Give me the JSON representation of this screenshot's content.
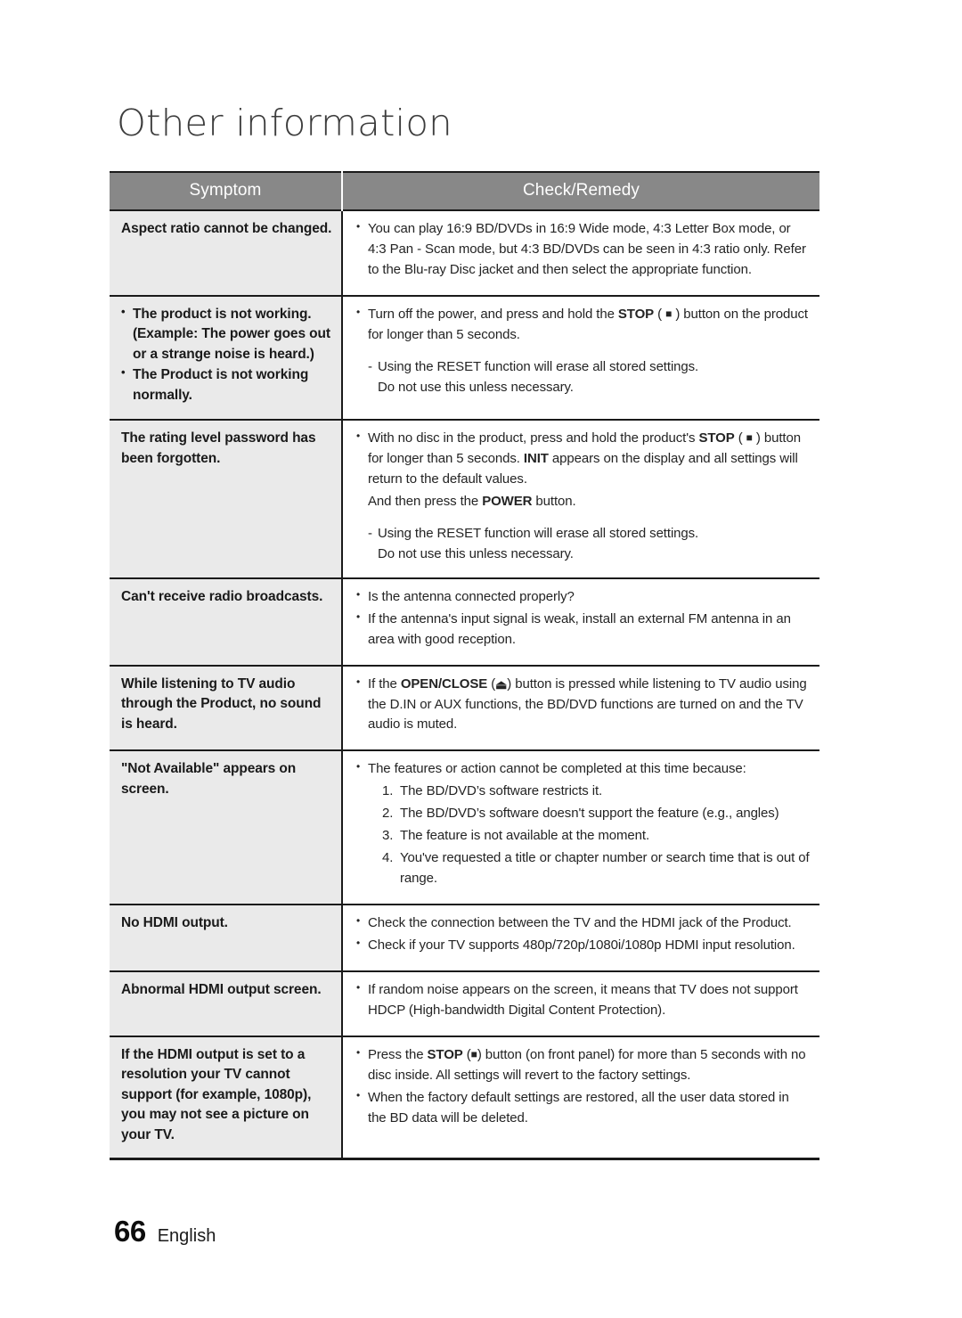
{
  "page": {
    "chapter_title": "Other information",
    "footer": {
      "page_number": "66",
      "language": "English"
    }
  },
  "table": {
    "headers": {
      "symptom": "Symptom",
      "remedy": "Check/Remedy"
    },
    "header_bg": "#888888",
    "symptom_cell_bg": "#eaeaea",
    "rows": [
      {
        "symptom_lines": [
          "Aspect ratio cannot be changed."
        ],
        "symptom_bulleted": false,
        "remedy_bullets": [
          "You can play 16:9 BD/DVDs in 16:9 Wide mode, 4:3 Letter Box mode, or 4:3 Pan - Scan mode, but 4:3 BD/DVDs can be seen in 4:3 ratio only. Refer to the Blu-ray Disc jacket and then select the appropriate function."
        ]
      },
      {
        "symptom_lines": [
          "The product is not working. (Example: The power goes out or a strange noise is heard.)",
          "The Product is not working normally."
        ],
        "symptom_bulleted": true,
        "remedy_bullets": [
          "Turn off the power, and press and hold the STOP ( ■ ) button on the product for longer than 5 seconds."
        ],
        "remedy_note_dash": "Using the RESET function will erase all stored settings.",
        "remedy_note_cont": "Do not use this unless necessary."
      },
      {
        "symptom_lines": [
          "The rating level password has been forgotten."
        ],
        "symptom_bulleted": false,
        "remedy_bullets": [
          "With no disc in the product, press and hold the product's STOP ( ■ ) button for longer than 5 seconds. INIT appears on the display and all settings will return to the default values."
        ],
        "remedy_plain": "And then press the POWER button.",
        "remedy_note_dash": "Using the RESET function will erase all stored settings.",
        "remedy_note_cont": "Do not use this unless necessary."
      },
      {
        "symptom_lines": [
          "Can't receive radio broadcasts."
        ],
        "symptom_bulleted": false,
        "remedy_bullets": [
          "Is the antenna connected properly?",
          "If the antenna's input signal is weak, install an external FM antenna in an area with good reception."
        ]
      },
      {
        "symptom_lines": [
          "While listening to TV audio through the Product, no sound is heard."
        ],
        "symptom_bulleted": false,
        "remedy_bullets": [
          "If the OPEN/CLOSE (⏏) button is pressed while listening to TV audio using the D.IN or AUX functions, the BD/DVD functions are turned on and the TV audio is muted."
        ]
      },
      {
        "symptom_lines": [
          "\"Not Available\" appears on screen."
        ],
        "symptom_bulleted": false,
        "remedy_bullets": [
          "The features or action cannot be completed at this time because:"
        ],
        "remedy_numbered": [
          "The BD/DVD’s software restricts it.",
          "The BD/DVD’s software doesn't support the feature (e.g., angles)",
          "The feature is not available at the moment.",
          "You've requested a title or chapter number or search time that is out of range."
        ]
      },
      {
        "symptom_lines": [
          "No HDMI output."
        ],
        "symptom_bulleted": false,
        "remedy_bullets": [
          "Check the connection between the TV and the HDMI jack of the Product.",
          "Check if your TV supports 480p/720p/1080i/1080p HDMI input resolution."
        ]
      },
      {
        "symptom_lines": [
          "Abnormal HDMI output screen."
        ],
        "symptom_bulleted": false,
        "remedy_bullets": [
          "If random noise appears on the screen, it means that TV does not support HDCP (High-bandwidth Digital Content Protection)."
        ]
      },
      {
        "symptom_lines": [
          "If the HDMI output is set to a resolution your TV cannot support (for example, 1080p), you may not see a picture on your TV."
        ],
        "symptom_bulleted": false,
        "remedy_bullets": [
          "Press the STOP (■) button (on front panel) for more than 5 seconds with no disc inside. All settings will revert to the factory settings.",
          "When the factory default settings are restored, all the user data stored in the BD data will be deleted."
        ]
      }
    ]
  },
  "icons": {
    "stop_square": "■",
    "eject": "⏏"
  }
}
